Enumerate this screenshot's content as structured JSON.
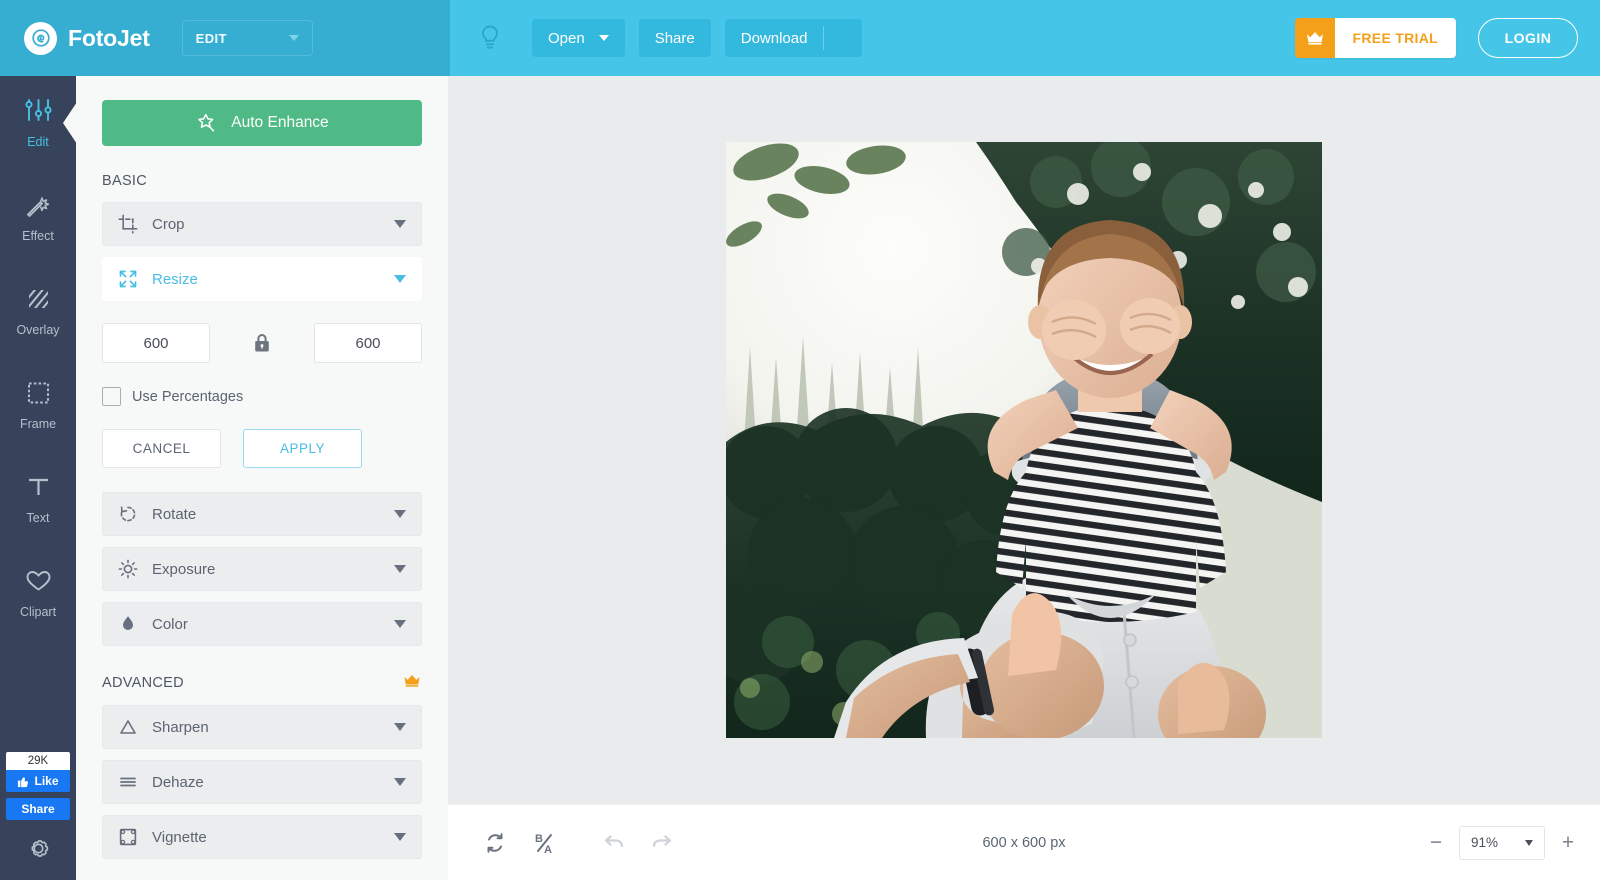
{
  "header": {
    "brand": "FotoJet",
    "mode_select": "EDIT",
    "buttons": {
      "open": "Open",
      "share": "Share",
      "download": "Download"
    },
    "free_trial": "FREE TRIAL",
    "login": "LOGIN",
    "colors": {
      "left_bg": "#35aed2",
      "right_bg": "#45c6e8",
      "trial_orange": "#f5a01b"
    }
  },
  "rail": {
    "items": [
      {
        "label": "Edit",
        "icon": "sliders-icon",
        "active": true
      },
      {
        "label": "Effect",
        "icon": "magic-wand-icon",
        "active": false
      },
      {
        "label": "Overlay",
        "icon": "hatch-square-icon",
        "active": false
      },
      {
        "label": "Frame",
        "icon": "frame-icon",
        "active": false
      },
      {
        "label": "Text",
        "icon": "text-t-icon",
        "active": false
      },
      {
        "label": "Clipart",
        "icon": "heart-icon",
        "active": false
      }
    ],
    "facebook": {
      "count": "29K",
      "like": "Like",
      "share": "Share"
    },
    "settings_icon": "gear-icon"
  },
  "panel": {
    "auto_enhance": "Auto Enhance",
    "basic_title": "BASIC",
    "advanced_title": "ADVANCED",
    "basic_rows": [
      {
        "label": "Crop",
        "icon": "crop-icon",
        "open": false
      },
      {
        "label": "Resize",
        "icon": "resize-arrows-icon",
        "open": true
      }
    ],
    "basic_rows_after": [
      {
        "label": "Rotate",
        "icon": "rotate-icon",
        "open": false
      },
      {
        "label": "Exposure",
        "icon": "sun-icon",
        "open": false
      },
      {
        "label": "Color",
        "icon": "droplet-icon",
        "open": false
      }
    ],
    "advanced_rows": [
      {
        "label": "Sharpen",
        "icon": "triangle-icon",
        "open": false
      },
      {
        "label": "Dehaze",
        "icon": "lines-icon",
        "open": false
      },
      {
        "label": "Vignette",
        "icon": "vignette-icon",
        "open": false
      }
    ],
    "resize": {
      "width_value": "600",
      "height_value": "600",
      "lock_icon": "lock-closed-icon",
      "use_percentages_label": "Use Percentages",
      "use_percentages_checked": false,
      "cancel_label": "CANCEL",
      "apply_label": "APPLY"
    },
    "crown_icon": "crown-icon"
  },
  "bottom": {
    "reset_icon": "reset-icon",
    "before_after_icon": "before-after-icon",
    "undo_icon": "undo-icon",
    "redo_icon": "redo-icon",
    "dimensions": "600 x 600 px",
    "zoom_out": "−",
    "zoom_in": "+",
    "zoom_value": "91%"
  },
  "canvas": {
    "collapse_handle": "〉∙‹",
    "chat_icon": "chat-bubble-icon",
    "photo_alt": "father-carrying-boy-on-shoulders-photo"
  }
}
